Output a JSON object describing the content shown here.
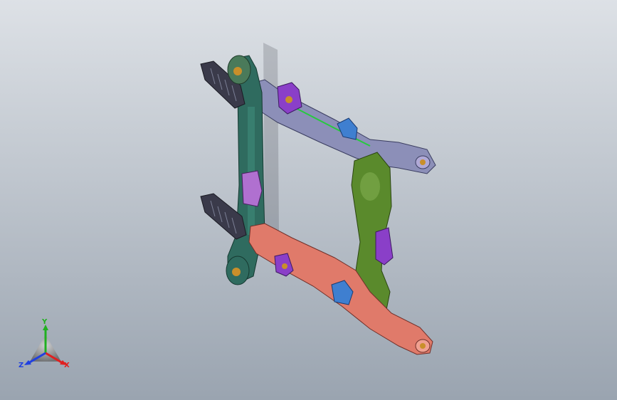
{
  "viewport": {
    "background_top": "#dde1e6",
    "background_bottom": "#9aa4b0"
  },
  "model": {
    "part_colors": {
      "left_rail": "#2f6b5f",
      "top_rail": "#8c8fb8",
      "right_rail": "#5a8a2c",
      "bottom_rail": "#e07a6a",
      "brackets": "#8a3fc8",
      "tabs": "#3f7fd0",
      "bushings": "#c98f2a",
      "corrugated_boots": "#3a3a4a",
      "accent_line": "#27c93f"
    }
  },
  "triad": {
    "x_label": "X",
    "y_label": "Y",
    "z_label": "Z",
    "x_color": "#e02020",
    "y_color": "#20b020",
    "z_color": "#2040e0"
  }
}
